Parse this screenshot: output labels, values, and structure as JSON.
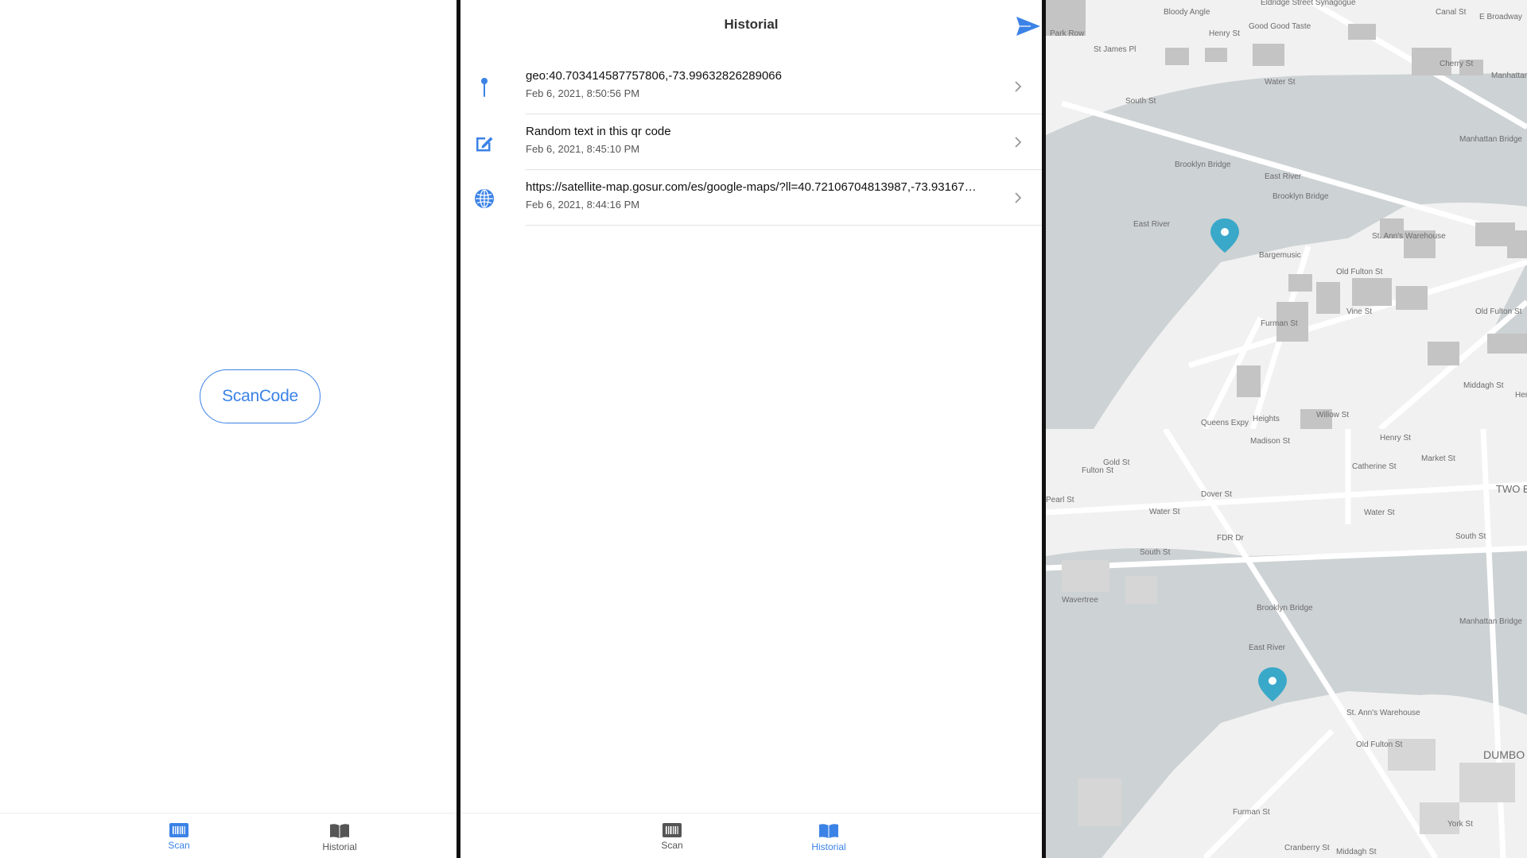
{
  "scan_screen": {
    "scan_button_label": "ScanCode",
    "tabs": [
      {
        "label": "Scan",
        "icon": "barcode-icon",
        "active": true
      },
      {
        "label": "Historial",
        "icon": "book-icon",
        "active": false
      }
    ]
  },
  "history_screen": {
    "title": "Historial",
    "send_icon": "send-icon",
    "items": [
      {
        "type": "geo",
        "icon": "pin-icon",
        "text": "geo:40.703414587757806,-73.99632826289066",
        "date": "Feb 6, 2021, 8:50:56 PM"
      },
      {
        "type": "text",
        "icon": "edit-icon",
        "text": "Random text in this qr code",
        "date": "Feb 6, 2021, 8:45:10 PM"
      },
      {
        "type": "url",
        "icon": "globe-icon",
        "text": "https://satellite-map.gosur.com/es/google-maps/?ll=40.72106704813987,-73.93167…",
        "date": "Feb 6, 2021, 8:44:16 PM"
      }
    ],
    "tabs": [
      {
        "label": "Scan",
        "icon": "barcode-icon",
        "active": false
      },
      {
        "label": "Historial",
        "icon": "book-icon",
        "active": true
      }
    ]
  },
  "map_top": {
    "labels": [
      "Bloody Angle",
      "Eldridge Street Synagogue",
      "Canal St",
      "E Broadway",
      "Good Good Taste",
      "Henry St",
      "Park Row",
      "St James Pl",
      "Water St",
      "Cherry St",
      "South St",
      "Manhattan Bridge",
      "Manhattan Bridge",
      "Brooklyn Bridge",
      "East River",
      "East River",
      "Brooklyn Bridge",
      "St. Ann's Warehouse",
      "Bargemusic",
      "Old Fulton St",
      "Furman St",
      "Vine St",
      "Old Fulton St",
      "Middagh St",
      "Willow St",
      "Queens Expy",
      "Heights",
      "Henry St"
    ]
  },
  "map_bottom": {
    "labels": [
      "Madison St",
      "Henry St",
      "Gold St",
      "Fulton St",
      "Catherine St",
      "Market St",
      "TWO BRIDGES",
      "Pearl St",
      "Water St",
      "Dover St",
      "Water St",
      "FDR Dr",
      "South St",
      "South St",
      "Wavertree",
      "Brooklyn Bridge",
      "Manhattan Bridge",
      "East River",
      "St. Ann's Warehouse",
      "Old Fulton St",
      "DUMBO",
      "Furman St",
      "York St",
      "Cranberry St",
      "Middagh St"
    ]
  },
  "colors": {
    "accent": "#3b82e6",
    "map_pin": "#3aa9c9",
    "water": "#cdd2d4",
    "land": "#f1f1f1"
  }
}
